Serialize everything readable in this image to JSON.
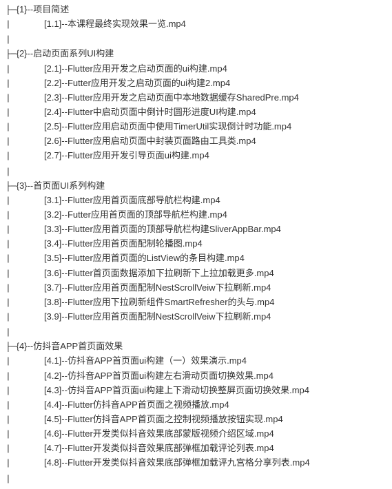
{
  "sections": [
    {
      "num": "{1}",
      "title": "项目简述",
      "items": [
        {
          "idx": "[1.1]",
          "name": "本课程最终实现效果一览.mp4"
        }
      ]
    },
    {
      "num": "{2}",
      "title": "启动页面系列UI构建",
      "items": [
        {
          "idx": "[2.1]",
          "name": "Flutter应用开发之启动页面的ui构建.mp4"
        },
        {
          "idx": "[2.2]",
          "name": "Futter应用开发之启动页面的ui构建2.mp4"
        },
        {
          "idx": "[2.3]",
          "name": "Flutter应用开发之启动页面中本地数据缓存SharedPre.mp4"
        },
        {
          "idx": "[2.4]",
          "name": "Flutter中启动页面中倒计时圆形进度UI构建.mp4"
        },
        {
          "idx": "[2.5]",
          "name": "Flutter应用启动页面中使用TimerUtil实现倒计时功能.mp4"
        },
        {
          "idx": "[2.6]",
          "name": "Flutter应用启动页面中封装页面路由工具类.mp4"
        },
        {
          "idx": "[2.7]",
          "name": "Flutter应用开发引导页面ui构建.mp4"
        }
      ]
    },
    {
      "num": "{3}",
      "title": "首页面UI系列构建",
      "items": [
        {
          "idx": "[3.1]",
          "name": "Flutter应用首页面底部导航栏构建.mp4"
        },
        {
          "idx": "[3.2]",
          "name": "Futter应用首页面的顶部导航栏构建.mp4"
        },
        {
          "idx": "[3.3]",
          "name": "Flutter应用首页面的顶部导航栏构建SliverAppBar.mp4"
        },
        {
          "idx": "[3.4]",
          "name": "Flutter应用首页面配制轮播图.mp4"
        },
        {
          "idx": "[3.5]",
          "name": "Flutter应用首页面的ListView的条目构建.mp4"
        },
        {
          "idx": "[3.6]",
          "name": "Flutter首页面数据添加下拉刷新下上拉加载更多.mp4"
        },
        {
          "idx": "[3.7]",
          "name": "Flutter应用首页面配制NestScrollVeiw下拉刷新.mp4"
        },
        {
          "idx": "[3.8]",
          "name": "Flutter应用下拉刷新组件SmartRefresher的头与.mp4"
        },
        {
          "idx": "[3.9]",
          "name": "Flutter应用首页面配制NestScrollVeiw下拉刷新.mp4"
        }
      ]
    },
    {
      "num": "{4}",
      "title": "仿抖音APP首页面效果",
      "items": [
        {
          "idx": "[4.1]",
          "name": "仿抖音APP首页面ui构建（一）效果演示.mp4"
        },
        {
          "idx": "[4.2]",
          "name": "仿抖音APP首页面ui构建左右滑动页面切换效果.mp4"
        },
        {
          "idx": "[4.3]",
          "name": "仿抖音APP首页面ui构建上下滑动切换整屏页面切换效果.mp4"
        },
        {
          "idx": "[4.4]",
          "name": "Flutter仿抖音APP首页面之视频播放.mp4"
        },
        {
          "idx": "[4.5]",
          "name": "Flutter仿抖音APP首页面之控制视频播放按钮实现.mp4"
        },
        {
          "idx": "[4.6]",
          "name": "Flutter开发类似抖音效果底部蒙版视频介绍区域.mp4"
        },
        {
          "idx": "[4.7]",
          "name": "Flutter开发类似抖音效果底部弹框加载评论列表.mp4"
        },
        {
          "idx": "[4.8]",
          "name": "Flutter开发类似抖音效果底部弹框加载评九宫格分享列表.mp4"
        }
      ]
    }
  ],
  "strings": {
    "branch_prefix": "├─",
    "bar": "|",
    "dash": "--"
  }
}
